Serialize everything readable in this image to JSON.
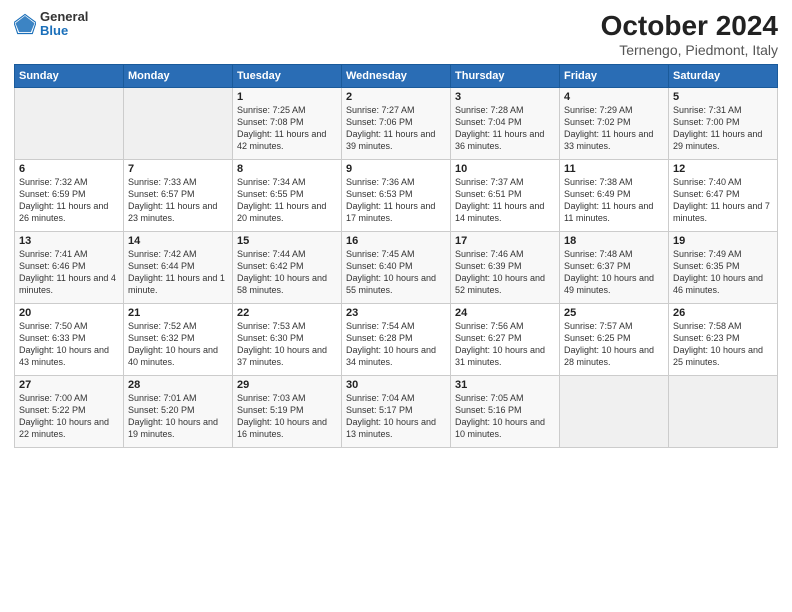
{
  "header": {
    "logo_general": "General",
    "logo_blue": "Blue",
    "title": "October 2024",
    "location": "Ternengo, Piedmont, Italy"
  },
  "columns": [
    "Sunday",
    "Monday",
    "Tuesday",
    "Wednesday",
    "Thursday",
    "Friday",
    "Saturday"
  ],
  "weeks": [
    [
      {
        "day": "",
        "content": ""
      },
      {
        "day": "",
        "content": ""
      },
      {
        "day": "1",
        "content": "Sunrise: 7:25 AM\nSunset: 7:08 PM\nDaylight: 11 hours and 42 minutes."
      },
      {
        "day": "2",
        "content": "Sunrise: 7:27 AM\nSunset: 7:06 PM\nDaylight: 11 hours and 39 minutes."
      },
      {
        "day": "3",
        "content": "Sunrise: 7:28 AM\nSunset: 7:04 PM\nDaylight: 11 hours and 36 minutes."
      },
      {
        "day": "4",
        "content": "Sunrise: 7:29 AM\nSunset: 7:02 PM\nDaylight: 11 hours and 33 minutes."
      },
      {
        "day": "5",
        "content": "Sunrise: 7:31 AM\nSunset: 7:00 PM\nDaylight: 11 hours and 29 minutes."
      }
    ],
    [
      {
        "day": "6",
        "content": "Sunrise: 7:32 AM\nSunset: 6:59 PM\nDaylight: 11 hours and 26 minutes."
      },
      {
        "day": "7",
        "content": "Sunrise: 7:33 AM\nSunset: 6:57 PM\nDaylight: 11 hours and 23 minutes."
      },
      {
        "day": "8",
        "content": "Sunrise: 7:34 AM\nSunset: 6:55 PM\nDaylight: 11 hours and 20 minutes."
      },
      {
        "day": "9",
        "content": "Sunrise: 7:36 AM\nSunset: 6:53 PM\nDaylight: 11 hours and 17 minutes."
      },
      {
        "day": "10",
        "content": "Sunrise: 7:37 AM\nSunset: 6:51 PM\nDaylight: 11 hours and 14 minutes."
      },
      {
        "day": "11",
        "content": "Sunrise: 7:38 AM\nSunset: 6:49 PM\nDaylight: 11 hours and 11 minutes."
      },
      {
        "day": "12",
        "content": "Sunrise: 7:40 AM\nSunset: 6:47 PM\nDaylight: 11 hours and 7 minutes."
      }
    ],
    [
      {
        "day": "13",
        "content": "Sunrise: 7:41 AM\nSunset: 6:46 PM\nDaylight: 11 hours and 4 minutes."
      },
      {
        "day": "14",
        "content": "Sunrise: 7:42 AM\nSunset: 6:44 PM\nDaylight: 11 hours and 1 minute."
      },
      {
        "day": "15",
        "content": "Sunrise: 7:44 AM\nSunset: 6:42 PM\nDaylight: 10 hours and 58 minutes."
      },
      {
        "day": "16",
        "content": "Sunrise: 7:45 AM\nSunset: 6:40 PM\nDaylight: 10 hours and 55 minutes."
      },
      {
        "day": "17",
        "content": "Sunrise: 7:46 AM\nSunset: 6:39 PM\nDaylight: 10 hours and 52 minutes."
      },
      {
        "day": "18",
        "content": "Sunrise: 7:48 AM\nSunset: 6:37 PM\nDaylight: 10 hours and 49 minutes."
      },
      {
        "day": "19",
        "content": "Sunrise: 7:49 AM\nSunset: 6:35 PM\nDaylight: 10 hours and 46 minutes."
      }
    ],
    [
      {
        "day": "20",
        "content": "Sunrise: 7:50 AM\nSunset: 6:33 PM\nDaylight: 10 hours and 43 minutes."
      },
      {
        "day": "21",
        "content": "Sunrise: 7:52 AM\nSunset: 6:32 PM\nDaylight: 10 hours and 40 minutes."
      },
      {
        "day": "22",
        "content": "Sunrise: 7:53 AM\nSunset: 6:30 PM\nDaylight: 10 hours and 37 minutes."
      },
      {
        "day": "23",
        "content": "Sunrise: 7:54 AM\nSunset: 6:28 PM\nDaylight: 10 hours and 34 minutes."
      },
      {
        "day": "24",
        "content": "Sunrise: 7:56 AM\nSunset: 6:27 PM\nDaylight: 10 hours and 31 minutes."
      },
      {
        "day": "25",
        "content": "Sunrise: 7:57 AM\nSunset: 6:25 PM\nDaylight: 10 hours and 28 minutes."
      },
      {
        "day": "26",
        "content": "Sunrise: 7:58 AM\nSunset: 6:23 PM\nDaylight: 10 hours and 25 minutes."
      }
    ],
    [
      {
        "day": "27",
        "content": "Sunrise: 7:00 AM\nSunset: 5:22 PM\nDaylight: 10 hours and 22 minutes."
      },
      {
        "day": "28",
        "content": "Sunrise: 7:01 AM\nSunset: 5:20 PM\nDaylight: 10 hours and 19 minutes."
      },
      {
        "day": "29",
        "content": "Sunrise: 7:03 AM\nSunset: 5:19 PM\nDaylight: 10 hours and 16 minutes."
      },
      {
        "day": "30",
        "content": "Sunrise: 7:04 AM\nSunset: 5:17 PM\nDaylight: 10 hours and 13 minutes."
      },
      {
        "day": "31",
        "content": "Sunrise: 7:05 AM\nSunset: 5:16 PM\nDaylight: 10 hours and 10 minutes."
      },
      {
        "day": "",
        "content": ""
      },
      {
        "day": "",
        "content": ""
      }
    ]
  ]
}
